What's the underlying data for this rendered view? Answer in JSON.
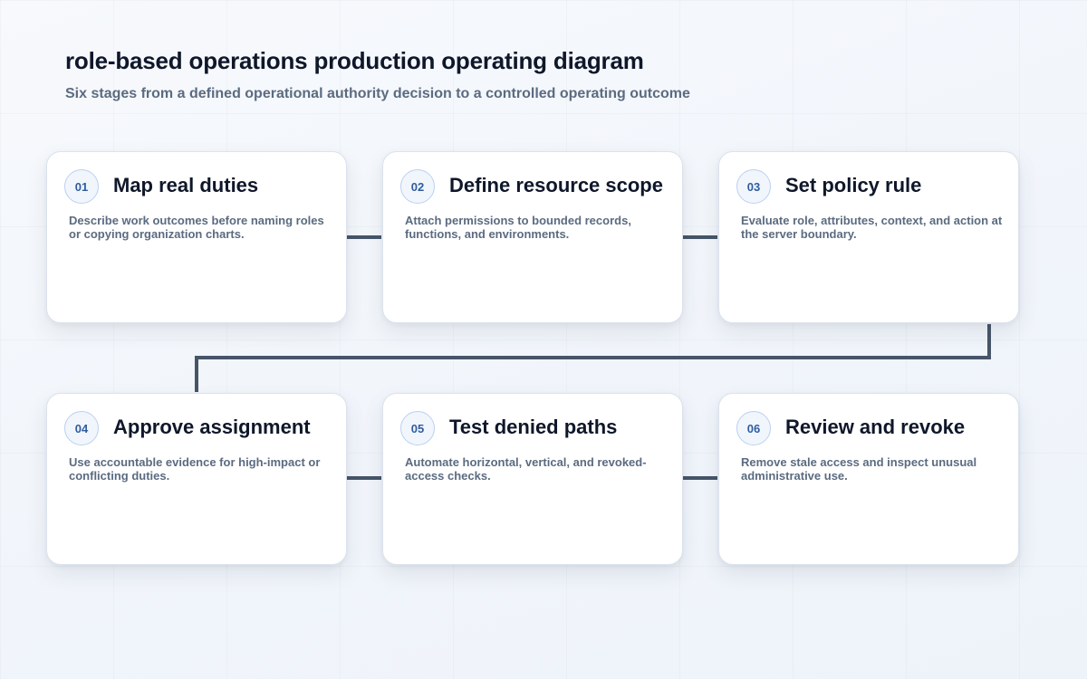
{
  "title": "role-based operations production operating diagram",
  "subtitle": "Six stages from a defined operational authority decision to a controlled operating outcome",
  "colors": {
    "connector": "#475569",
    "badge_text": "#2f5d9e",
    "badge_border": "#bcd0ee",
    "card_title": "#0f172a",
    "card_text": "#5b6b80"
  },
  "stages": [
    {
      "number": "01",
      "title": "Map real duties",
      "description": "Describe work outcomes before naming roles or copying organization charts."
    },
    {
      "number": "02",
      "title": "Define resource scope",
      "description": "Attach permissions to bounded records, functions, and environments."
    },
    {
      "number": "03",
      "title": "Set policy rule",
      "description": "Evaluate role, attributes, context, and action at the server boundary."
    },
    {
      "number": "04",
      "title": "Approve assignment",
      "description": "Use accountable evidence for high-impact or conflicting duties."
    },
    {
      "number": "05",
      "title": "Test denied paths",
      "description": "Automate horizontal, vertical, and revoked-access checks."
    },
    {
      "number": "06",
      "title": "Review and revoke",
      "description": "Remove stale access and inspect unusual administrative use."
    }
  ]
}
